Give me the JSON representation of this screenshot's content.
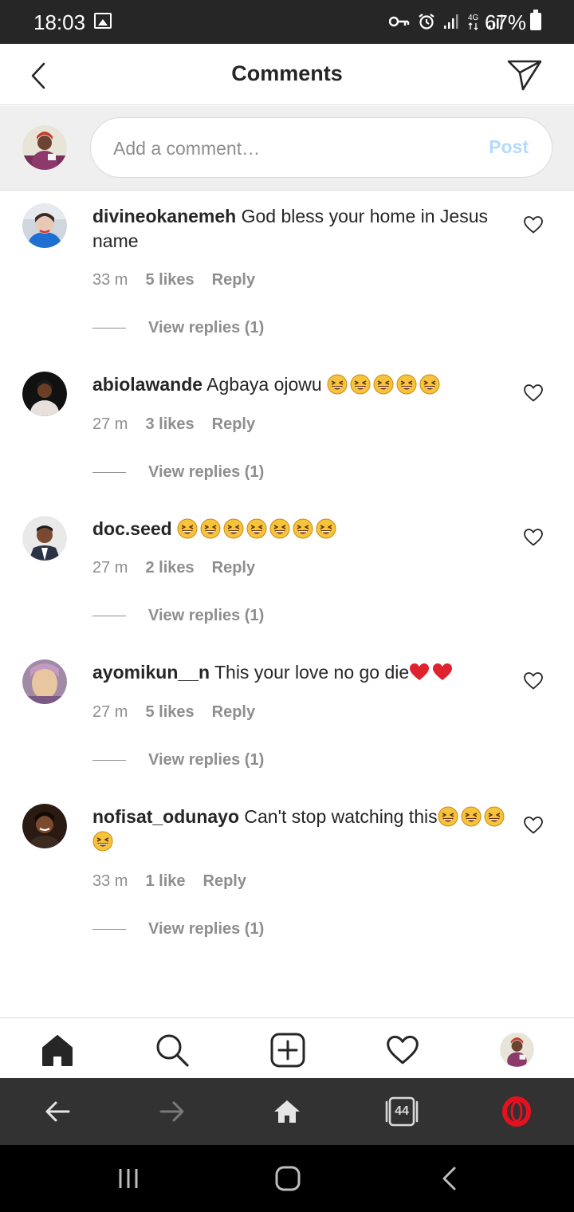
{
  "status_bar": {
    "time": "18:03",
    "network": "4G",
    "battery": "67%",
    "icons": [
      "image-icon",
      "vpn-key-icon",
      "alarm-icon",
      "signal-icon",
      "battery-icon"
    ]
  },
  "header": {
    "title": "Comments",
    "back_icon": "chevron-left-icon",
    "send_icon": "paper-plane-icon"
  },
  "composer": {
    "placeholder": "Add a comment…",
    "post_label": "Post",
    "post_color": "#b3dbff"
  },
  "comments": [
    {
      "username": "divineokanemeh",
      "text": "God bless your home in Jesus name",
      "emoji_count": 0,
      "time": "33 m",
      "likes": "5 likes",
      "reply_label": "Reply",
      "view_replies": "View replies (1)"
    },
    {
      "username": "abiolawande",
      "text": "Agbaya ojowu",
      "emoji": "grinning-squinting-face",
      "emoji_count": 5,
      "time": "27 m",
      "likes": "3 likes",
      "reply_label": "Reply",
      "view_replies": "View replies (1)"
    },
    {
      "username": "doc.seed",
      "text": "",
      "emoji": "grinning-squinting-face",
      "emoji_count": 7,
      "time": "27 m",
      "likes": "2 likes",
      "reply_label": "Reply",
      "view_replies": "View replies (1)"
    },
    {
      "username": "ayomikun__n",
      "text": "This your love no go die",
      "emoji": "red-heart",
      "emoji_count": 2,
      "time": "27 m",
      "likes": "5 likes",
      "reply_label": "Reply",
      "view_replies": "View replies (1)"
    },
    {
      "username": "nofisat_odunayo",
      "text": "Can't stop watching this",
      "emoji": "grinning-squinting-face",
      "emoji_count": 4,
      "time": "33 m",
      "likes": "1 like",
      "reply_label": "Reply",
      "view_replies": "View replies (1)"
    }
  ],
  "bottom_nav": {
    "items": [
      "home-icon",
      "search-icon",
      "new-post-icon",
      "activity-heart-icon",
      "profile-avatar"
    ]
  },
  "browser_bar": {
    "tabs_count": "44",
    "items": [
      "back-arrow-icon",
      "forward-arrow-icon",
      "home-icon",
      "tabs-icon",
      "opera-icon"
    ],
    "opera_color": "#e8101f"
  },
  "system_nav": {
    "items": [
      "recents-icon",
      "home-icon",
      "back-icon"
    ]
  }
}
